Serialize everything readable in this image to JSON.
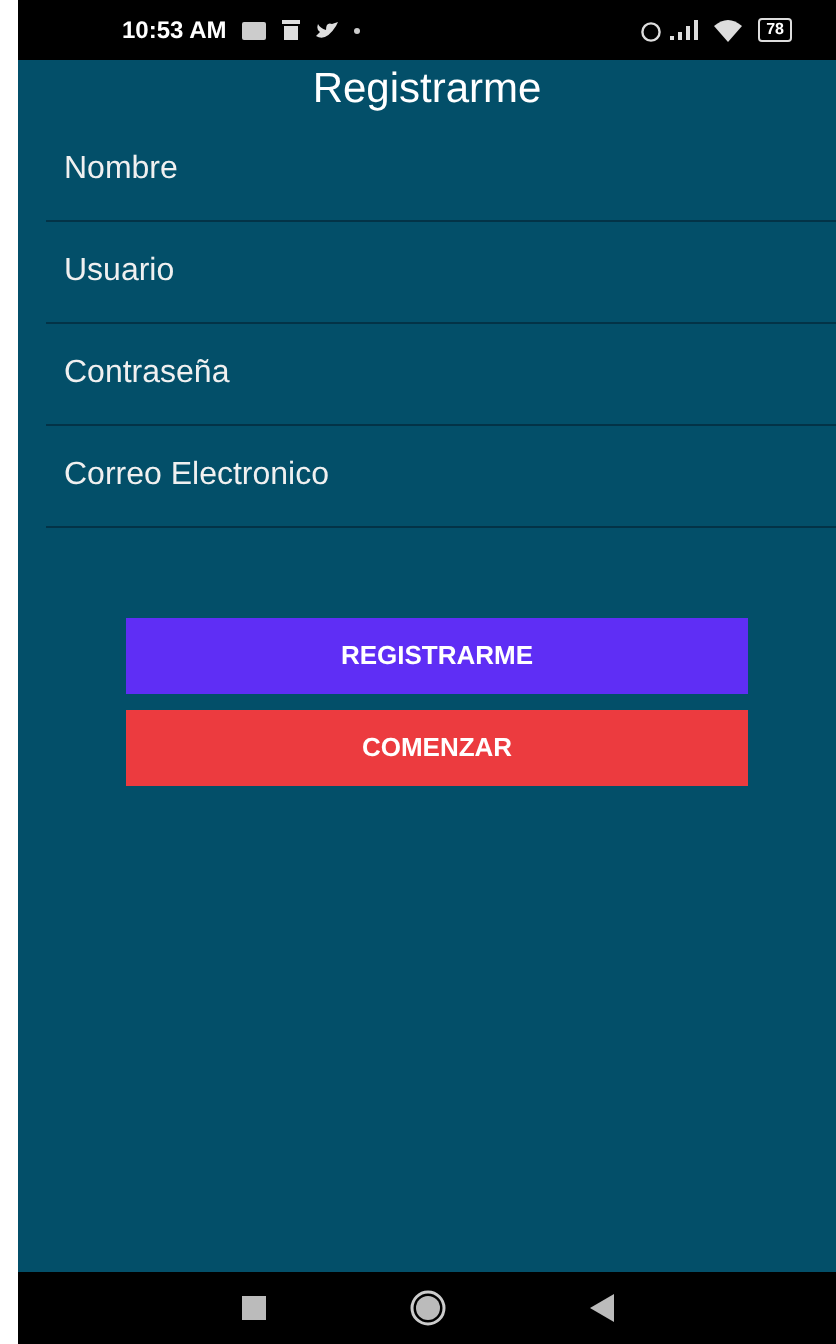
{
  "status_bar": {
    "time": "10:53 AM",
    "battery": "78"
  },
  "title": "Registrarme",
  "fields": [
    {
      "placeholder": "Nombre"
    },
    {
      "placeholder": "Usuario"
    },
    {
      "placeholder": "Contraseña"
    },
    {
      "placeholder": "Correo Electronico"
    }
  ],
  "buttons": [
    {
      "label": "REGISTRARME",
      "color": "#5f2ef5"
    },
    {
      "label": "COMENZAR",
      "color": "#ec3b3f"
    }
  ]
}
